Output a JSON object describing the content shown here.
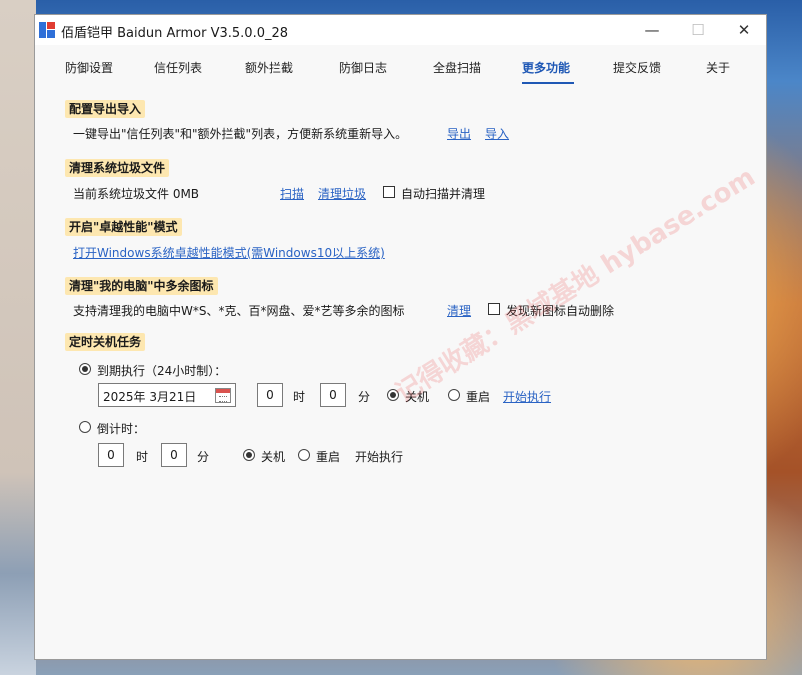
{
  "window": {
    "title": "佰盾铠甲 Baidun Armor  V3.5.0.0_28",
    "controls": {
      "minimize": "—",
      "maximize": "☐",
      "close": "✕"
    }
  },
  "tabs": [
    {
      "label": "防御设置"
    },
    {
      "label": "信任列表"
    },
    {
      "label": "额外拦截"
    },
    {
      "label": "防御日志"
    },
    {
      "label": "全盘扫描"
    },
    {
      "label": "更多功能",
      "active": true
    },
    {
      "label": "提交反馈"
    },
    {
      "label": "关于"
    }
  ],
  "config_io": {
    "heading": "配置导出导入",
    "description": "一键导出\"信任列表\"和\"额外拦截\"列表，方便新系统重新导入。",
    "export_label": "导出",
    "import_label": "导入"
  },
  "junk": {
    "heading": "清理系统垃圾文件",
    "current_label": "当前系统垃圾文件  0MB",
    "scan_label": "扫描",
    "clean_label": "清理垃圾",
    "auto_label": "自动扫描并清理",
    "auto_checked": false
  },
  "performance": {
    "heading": "开启\"卓越性能\"模式",
    "link_label": "打开Windows系统卓越性能模式(需Windows10以上系统)"
  },
  "icons_cleanup": {
    "heading": "清理\"我的电脑\"中多余图标",
    "description": "支持清理我的电脑中W*S、*克、百*网盘、爱*艺等多余的图标",
    "clean_label": "清理",
    "auto_label": "发现新图标自动删除",
    "auto_checked": false
  },
  "shutdown": {
    "heading": "定时关机任务",
    "at_time_label": "到期执行（24小时制）：",
    "at_time_selected": true,
    "date_value": "2025年  3月21日",
    "hour_value": "0",
    "minute_value": "0",
    "hour_unit": "时",
    "minute_unit": "分",
    "shutdown_label": "关机",
    "restart_label": "重启",
    "start_label": "开始执行",
    "countdown_label": "倒计时：",
    "countdown_selected": false,
    "cd_hour_value": "0",
    "cd_minute_value": "0",
    "cd_shutdown_label": "关机",
    "cd_restart_label": "重启",
    "cd_start_label": "开始执行"
  },
  "watermark_text": "记得收藏：黑域基地  hybase.com",
  "colors": {
    "accent": "#1f58b5",
    "link": "#2a63c4",
    "section_highlight": "#fde7b0"
  }
}
